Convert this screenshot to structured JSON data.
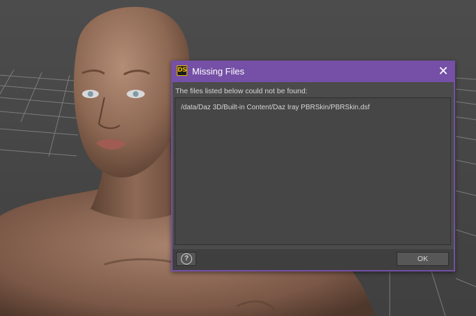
{
  "dialog": {
    "title": "Missing Files",
    "app_logo_text": "DS",
    "close_glyph": "✕",
    "message": "The files listed below could not be found:",
    "missing_files": [
      "/data/Daz 3D/Built-in Content/Daz Iray PBRSkin/PBRSkin.dsf"
    ],
    "help_glyph": "?",
    "ok_label": "OK"
  },
  "colors": {
    "titlebar": "#7550a6",
    "dialog_body": "#4b4b4b",
    "viewport_background": "#4a4a4a",
    "logo_accent": "#e3b900"
  },
  "icons": [
    "daz-studio-logo-icon",
    "close-icon",
    "help-icon"
  ]
}
